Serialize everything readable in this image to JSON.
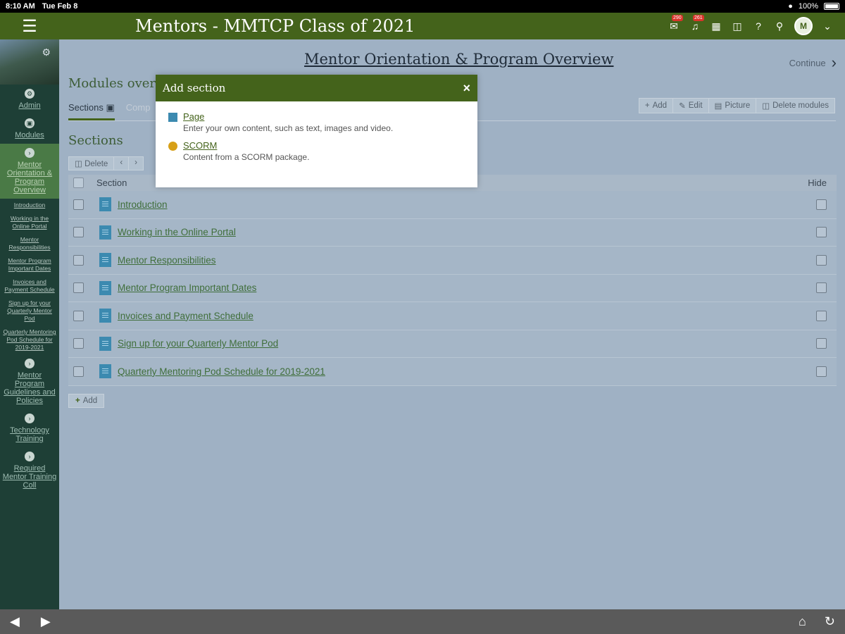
{
  "status_bar": {
    "time": "8:10 AM",
    "date": "Tue Feb 8",
    "battery": "100%"
  },
  "header": {
    "title": "Mentors - MMTCP Class of 2021",
    "badges": {
      "mail": "290",
      "notifications": "261"
    },
    "avatar_initials": "M"
  },
  "sidebar": {
    "items": [
      {
        "label": "Admin",
        "icon": "gear-icon"
      },
      {
        "label": "Modules",
        "icon": "book-icon"
      },
      {
        "label": "Mentor Orientation & Program Overview",
        "icon": "chevron-right-icon"
      }
    ],
    "sub_items": [
      "Introduction",
      "Working in the Online Portal",
      "Mentor Responsibilities",
      "Mentor Program Important Dates",
      "Invoices and Payment Schedule",
      "Sign up for your Quarterly Mentor Pod",
      "Quarterly Mentoring Pod Schedule for 2019-2021"
    ],
    "more_items": [
      "Mentor Program Guidelines and Policies",
      "Technology Training",
      "Required Mentor Training Coll"
    ]
  },
  "main": {
    "page_title": "Mentor Orientation & Program Overview",
    "continue_label": "Continue",
    "modules_heading": "Modules overv",
    "tabs": [
      {
        "label": "Sections"
      },
      {
        "label": "Comp"
      }
    ],
    "toolbar": {
      "add": "Add",
      "edit": "Edit",
      "picture": "Picture",
      "delete_modules": "Delete modules"
    },
    "sections_heading": "Sections",
    "delete_label": "Delete",
    "table": {
      "col_section": "Section",
      "col_hide": "Hide",
      "rows": [
        "Introduction",
        "Working in the Online Portal",
        "Mentor Responsibilities",
        "Mentor Program Important Dates",
        "Invoices and Payment Schedule",
        "Sign up for your Quarterly Mentor Pod",
        "Quarterly Mentoring Pod Schedule for 2019-2021"
      ]
    },
    "add_label": "Add"
  },
  "modal": {
    "title": "Add section",
    "close": "×",
    "options": [
      {
        "title": "Page",
        "description": "Enter your own content, such as text, images and video."
      },
      {
        "title": "SCORM",
        "description": "Content from a SCORM package."
      }
    ]
  }
}
